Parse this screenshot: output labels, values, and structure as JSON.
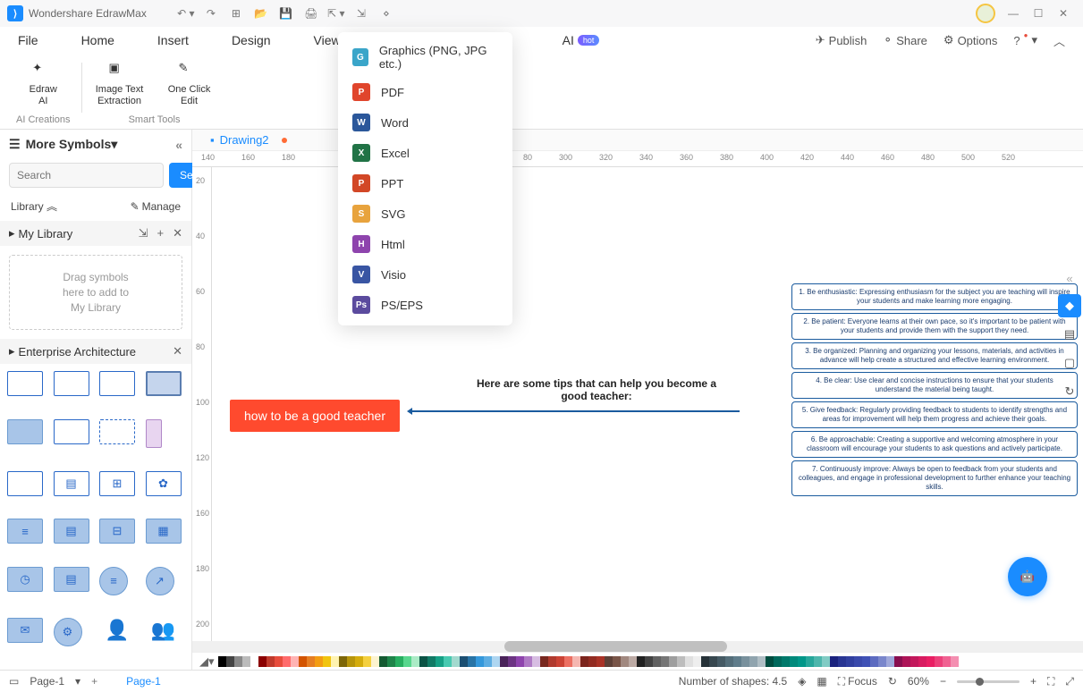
{
  "app": {
    "title": "Wondershare EdrawMax"
  },
  "menu": {
    "items": [
      "File",
      "Home",
      "Insert",
      "Design",
      "View"
    ],
    "ai": "AI",
    "hot": "hot"
  },
  "topActions": {
    "publish": "Publish",
    "share": "Share",
    "options": "Options"
  },
  "ribbon": {
    "groups": [
      {
        "label": "AI Creations",
        "tools": [
          {
            "name": "Edraw\nAI",
            "icon": "ai"
          }
        ]
      },
      {
        "label": "Smart Tools",
        "tools": [
          {
            "name": "Image Text\nExtraction",
            "icon": "ocr"
          },
          {
            "name": "One Click\nEdit",
            "icon": "edit"
          }
        ]
      }
    ]
  },
  "sidebar": {
    "title": "More Symbols",
    "searchPlaceholder": "Search",
    "searchBtn": "Search",
    "library": "Library",
    "manage": "Manage",
    "mylib": "My Library",
    "dropzone": "Drag symbols\nhere to add to\nMy Library",
    "entarch": "Enterprise Architecture"
  },
  "doc": {
    "tab": "Drawing2",
    "page": "Page-1"
  },
  "exportMenu": [
    {
      "label": "Graphics (PNG, JPG etc.)",
      "color": "#3aa5c9",
      "ic": "G"
    },
    {
      "label": "PDF",
      "color": "#e0452c",
      "ic": "P"
    },
    {
      "label": "Word",
      "color": "#2b579a",
      "ic": "W"
    },
    {
      "label": "Excel",
      "color": "#217346",
      "ic": "X"
    },
    {
      "label": "PPT",
      "color": "#d24726",
      "ic": "P"
    },
    {
      "label": "SVG",
      "color": "#e8a33d",
      "ic": "S"
    },
    {
      "label": "Html",
      "color": "#8e44ad",
      "ic": "H"
    },
    {
      "label": "Visio",
      "color": "#3955a3",
      "ic": "V"
    },
    {
      "label": "PS/EPS",
      "color": "#5b4b9e",
      "ic": "Ps"
    }
  ],
  "canvas": {
    "root": "how to be a good teacher",
    "subtitle": "Here are some tips that can help you become a good teacher:",
    "tips": [
      "1. Be enthusiastic: Expressing enthusiasm for the subject you are teaching will inspire your students and make learning more engaging.",
      "2. Be patient: Everyone learns at their own pace, so it's important to be patient with your students and provide them with the support they need.",
      "3. Be organized: Planning and organizing your lessons, materials, and activities in advance will help create a structured and effective learning environment.",
      "4. Be clear: Use clear and concise instructions to ensure that your students understand the material being taught.",
      "5. Give feedback: Regularly providing feedback to students to identify strengths and areas for improvement will help them progress and achieve their goals.",
      "6. Be approachable: Creating a supportive and welcoming atmosphere in your classroom will encourage your students to ask questions and actively participate.",
      "7. Continuously improve: Always be open to feedback from your students and colleagues, and engage in professional development to further enhance your teaching skills."
    ]
  },
  "rulerH": [
    140,
    160,
    180,
    80,
    300,
    320,
    340,
    360,
    380,
    400,
    420,
    440,
    460,
    480,
    500,
    520
  ],
  "rulerV": [
    20,
    40,
    60,
    80,
    100,
    120,
    160,
    180,
    200
  ],
  "status": {
    "shapes": "Number of shapes: 4.5",
    "focus": "Focus",
    "zoom": "60%",
    "page": "Page-1"
  },
  "colors": [
    "#000",
    "#444",
    "#888",
    "#bbb",
    "#fff",
    "#8b0000",
    "#c0392b",
    "#e74c3c",
    "#ff6b6b",
    "#ffb3b3",
    "#d35400",
    "#e67e22",
    "#f39c12",
    "#f1c40f",
    "#fff3b0",
    "#7d6608",
    "#b7950b",
    "#d4ac0d",
    "#f4d03f",
    "#fcf3cf",
    "#145a32",
    "#1e8449",
    "#27ae60",
    "#58d68d",
    "#abebc6",
    "#0b5345",
    "#117a65",
    "#16a085",
    "#48c9b0",
    "#a2d9ce",
    "#1b4f72",
    "#2874a6",
    "#3498db",
    "#5dade2",
    "#aed6f1",
    "#4a235a",
    "#6c3483",
    "#8e44ad",
    "#af7ac5",
    "#d7bde2",
    "#78281f",
    "#b03a2e",
    "#cb4335",
    "#ec7063",
    "#f5b7b1",
    "#7b241c",
    "#922b21",
    "#a93226",
    "#5d4037",
    "#795548",
    "#a1887f",
    "#bcaaa4",
    "#212121",
    "#424242",
    "#616161",
    "#757575",
    "#9e9e9e",
    "#bdbdbd",
    "#e0e0e0",
    "#eeeeee",
    "#263238",
    "#37474f",
    "#455a64",
    "#546e7a",
    "#607d8b",
    "#78909c",
    "#90a4ae",
    "#b0bec5",
    "#004d40",
    "#00695c",
    "#00796b",
    "#00897b",
    "#009688",
    "#26a69a",
    "#4db6ac",
    "#80cbc4",
    "#1a237e",
    "#283593",
    "#303f9f",
    "#3949ab",
    "#3f51b5",
    "#5c6bc0",
    "#7986cb",
    "#9fa8da",
    "#880e4f",
    "#ad1457",
    "#c2185b",
    "#d81b60",
    "#e91e63",
    "#ec407a",
    "#f06292",
    "#f48fb1"
  ]
}
